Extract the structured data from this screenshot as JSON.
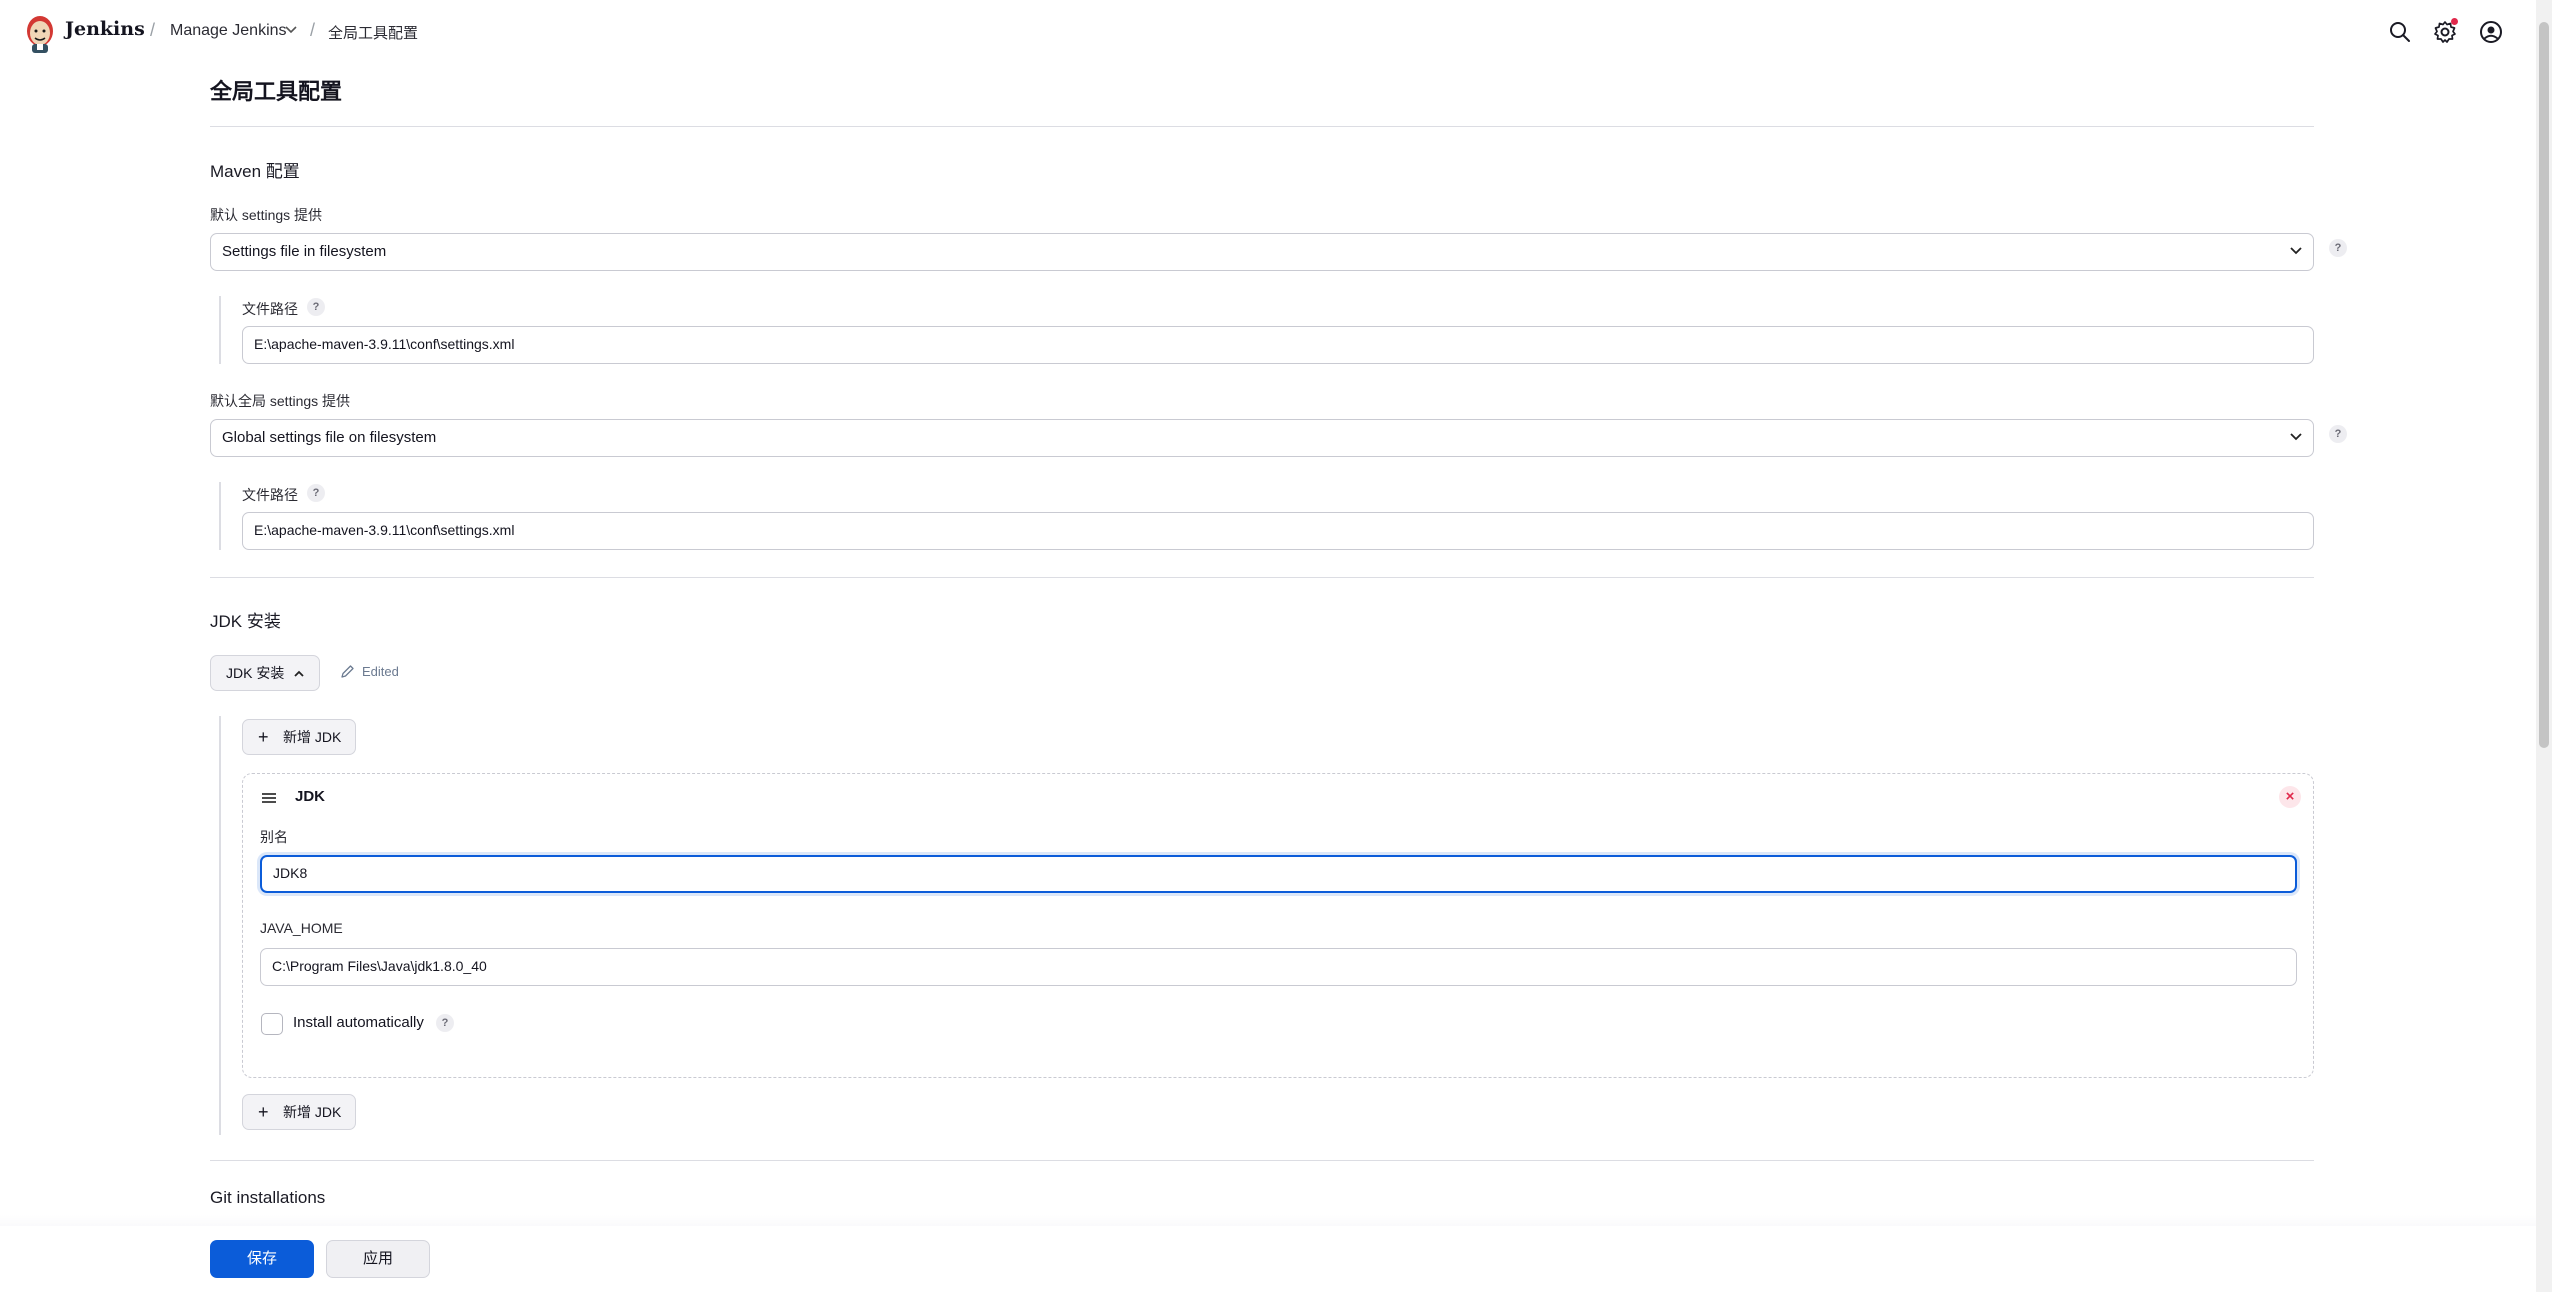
{
  "header": {
    "brand": "Jenkins",
    "breadcrumbs": [
      "Manage Jenkins",
      "全局工具配置"
    ],
    "notification_color": "#e0284b",
    "icons": [
      "search-icon",
      "gear-icon",
      "user-icon"
    ]
  },
  "page": {
    "title": "全局工具配置"
  },
  "maven": {
    "section_title": "Maven 配置",
    "settings_label": "默认 settings 提供",
    "settings_value": "Settings file in filesystem",
    "file_path_label": "文件路径",
    "settings_path": "E:\\apache-maven-3.9.11\\conf\\settings.xml",
    "global_settings_label": "默认全局 settings 提供",
    "global_settings_value": "Global settings file on filesystem",
    "global_file_path_label": "文件路径",
    "global_settings_path": "E:\\apache-maven-3.9.11\\conf\\settings.xml"
  },
  "jdk": {
    "section_title": "JDK 安装",
    "toggle_label": "JDK 安装",
    "edited_label": "Edited",
    "add_button_label": "新增 JDK",
    "card_title": "JDK",
    "alias_label": "别名",
    "alias_value": "JDK8",
    "java_home_label": "JAVA_HOME",
    "java_home_value": "C:\\Program Files\\Java\\jdk1.8.0_40",
    "install_auto_label": "Install automatically",
    "install_auto_checked": false
  },
  "git": {
    "section_title": "Git installations"
  },
  "footer": {
    "save_label": "保存",
    "apply_label": "应用",
    "accent_color": "#0b5cd9"
  },
  "help_glyph": "?"
}
